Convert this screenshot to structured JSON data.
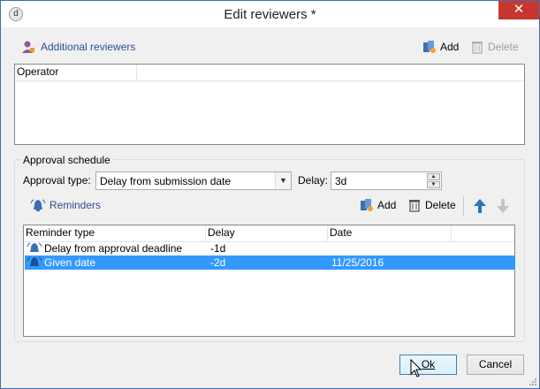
{
  "window": {
    "title": "Edit reviewers *",
    "close_glyph": "✕"
  },
  "reviewers": {
    "link_label": "Additional reviewers",
    "add_label": "Add",
    "delete_label": "Delete",
    "columns": [
      "Operator"
    ]
  },
  "schedule": {
    "group_label": "Approval schedule",
    "approval_type_label": "Approval type:",
    "approval_type_value": "Delay from submission date",
    "delay_label": "Delay:",
    "delay_value": "3d"
  },
  "reminders": {
    "link_label": "Reminders",
    "add_label": "Add",
    "delete_label": "Delete",
    "columns": [
      "Reminder type",
      "Delay",
      "Date"
    ],
    "rows": [
      {
        "type": "Delay from approval deadline",
        "delay": "-1d",
        "date": ""
      },
      {
        "type": "Given date",
        "delay": "-2d",
        "date": "11/25/2016"
      }
    ],
    "selected_row": 1
  },
  "footer": {
    "ok_label": "Ok",
    "cancel_label": "Cancel"
  },
  "colors": {
    "selection": "#3399ff",
    "link": "#2b4e9b",
    "close": "#c7372d"
  }
}
